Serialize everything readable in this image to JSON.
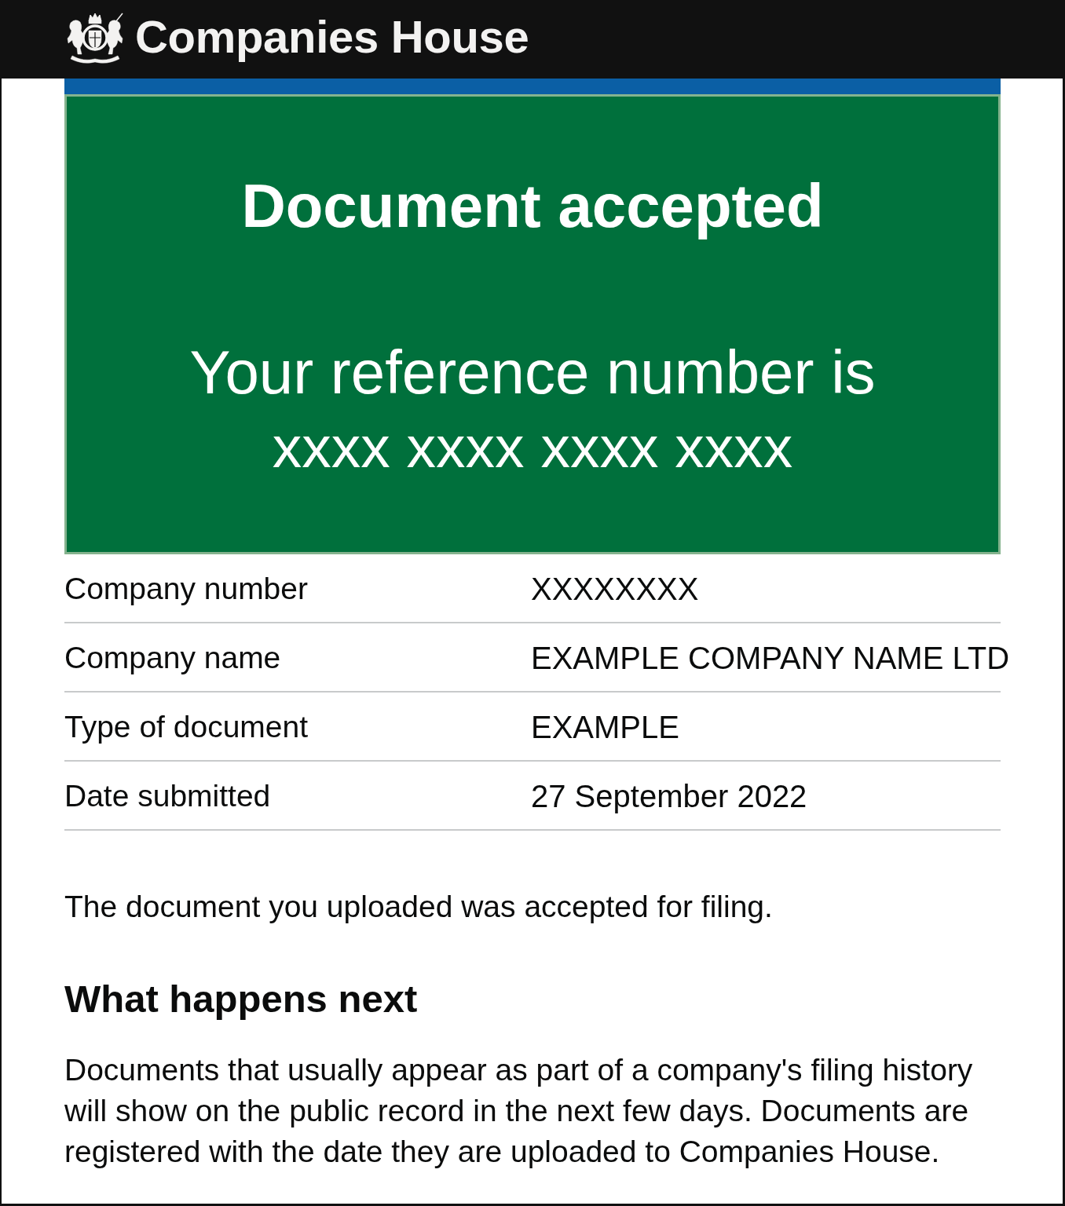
{
  "header": {
    "title": "Companies House"
  },
  "panel": {
    "title": "Document accepted",
    "body": "Your reference number is",
    "reference": "xxxx xxxx xxxx xxxx"
  },
  "summary": [
    {
      "key": "Company number",
      "value": "XXXXXXXX"
    },
    {
      "key": "Company name",
      "value": "EXAMPLE COMPANY NAME LTD"
    },
    {
      "key": "Type of document",
      "value": "EXAMPLE"
    },
    {
      "key": "Date submitted",
      "value": "27 September 2022"
    }
  ],
  "content": {
    "intro": "The document you uploaded was accepted for filing.",
    "heading": "What happens next",
    "paragraph": "Documents that usually appear as part of a company's filing history will show on the public record in the next few days. Documents are registered with the date they are uploaded to Companies House."
  }
}
